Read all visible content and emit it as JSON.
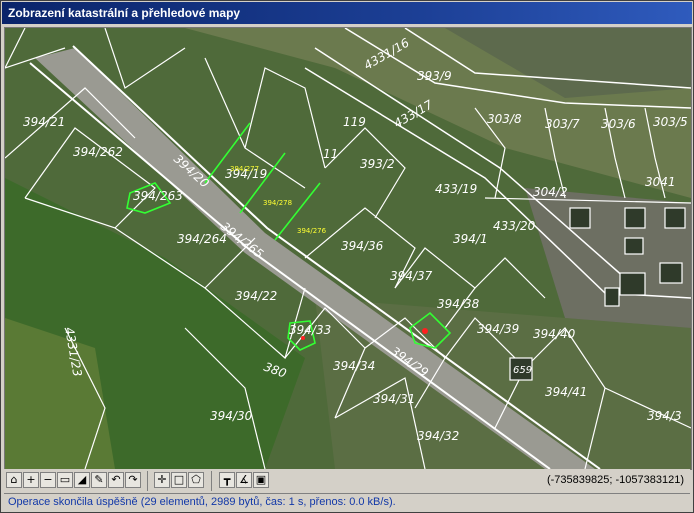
{
  "window": {
    "title": "Zobrazení katastrální a přehledové mapy"
  },
  "map": {
    "parcel_labels": [
      {
        "text": "394/20"
      },
      {
        "text": "394/265"
      },
      {
        "text": "394/29"
      },
      {
        "text": "380"
      },
      {
        "text": "394/21"
      },
      {
        "text": "394/262"
      },
      {
        "text": "394/263"
      },
      {
        "text": "394/264"
      },
      {
        "text": "394/22"
      },
      {
        "text": "394/33"
      },
      {
        "text": "394/34"
      },
      {
        "text": "394/31"
      },
      {
        "text": "394/32"
      },
      {
        "text": "394/30"
      },
      {
        "text": "394/36"
      },
      {
        "text": "394/37"
      },
      {
        "text": "394/38"
      },
      {
        "text": "394/39"
      },
      {
        "text": "394/40"
      },
      {
        "text": "394/41"
      },
      {
        "text": "394/3"
      },
      {
        "text": "393/2"
      },
      {
        "text": "393/9"
      },
      {
        "text": "303/8"
      },
      {
        "text": "303/7"
      },
      {
        "text": "303/6"
      },
      {
        "text": "303/5"
      },
      {
        "text": "433/19"
      },
      {
        "text": "433/20"
      },
      {
        "text": "394/19"
      },
      {
        "text": "394/1"
      },
      {
        "text": "304/2"
      },
      {
        "text": "3041"
      },
      {
        "text": "659"
      },
      {
        "text": "4331/16"
      },
      {
        "text": "433/17"
      },
      {
        "text": "4331/23"
      },
      {
        "text": "119"
      },
      {
        "text": "11"
      }
    ],
    "highlight_labels": [
      {
        "text": "394/277"
      },
      {
        "text": "394/278"
      },
      {
        "text": "394/276"
      }
    ]
  },
  "toolbar": {
    "buttons": [
      {
        "name": "home-icon",
        "glyph": "⌂"
      },
      {
        "name": "zoom-in-icon",
        "glyph": "+"
      },
      {
        "name": "zoom-out-icon",
        "glyph": "−"
      },
      {
        "name": "full-extent-icon",
        "glyph": "▭"
      },
      {
        "name": "area-icon",
        "glyph": "◢"
      },
      {
        "name": "pencil-icon",
        "glyph": "✎"
      },
      {
        "name": "undo-icon",
        "glyph": "↶"
      },
      {
        "name": "redo-icon",
        "glyph": "↷"
      },
      {
        "name": "crosshair-icon",
        "glyph": "✛"
      },
      {
        "name": "rectangle-select-icon",
        "glyph": "□"
      },
      {
        "name": "polygon-select-icon",
        "glyph": "⬠"
      },
      {
        "name": "measure-icon",
        "glyph": "┳"
      },
      {
        "name": "angle-icon",
        "glyph": "∡"
      },
      {
        "name": "print-icon",
        "glyph": "▣"
      }
    ],
    "coordinates": "(-735839825; -1057383121)"
  },
  "status": {
    "text": "Operace skončila úspěšně (29 elementů, 2989 bytů, čas: 1 s, přenos: 0.0 kB/s)."
  },
  "colors": {
    "titlebar": "#0a246a",
    "parcel_line": "#ffffff",
    "highlight": "#33ff33",
    "label_yellow": "#ffff33",
    "status_text": "#1238a8"
  }
}
